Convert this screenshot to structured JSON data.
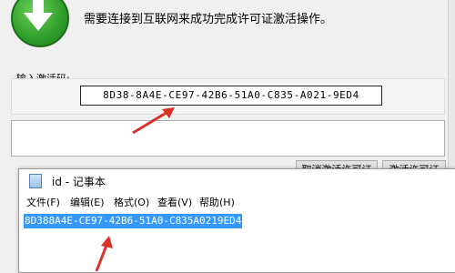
{
  "dialog": {
    "message": "需要连接到互联网来成功完成许可证激活操作。",
    "activation_label": "输入激活码:",
    "activation_code": "8D38-8A4E-CE97-42B6-51A0-C835-A021-9ED4",
    "buttons": {
      "cancel": "取消激活许可证",
      "activate": "激活许可证"
    }
  },
  "notepad": {
    "title": "id - 记事本",
    "menu": [
      "文件(F)",
      "编辑(E)",
      "格式(O)",
      "查看(V)",
      "帮助(H)"
    ],
    "content": "8D388A4E-CE97-42B6-51A0-C835A0219ED4"
  },
  "annotations": {
    "arrow_color": "#d9322b"
  }
}
